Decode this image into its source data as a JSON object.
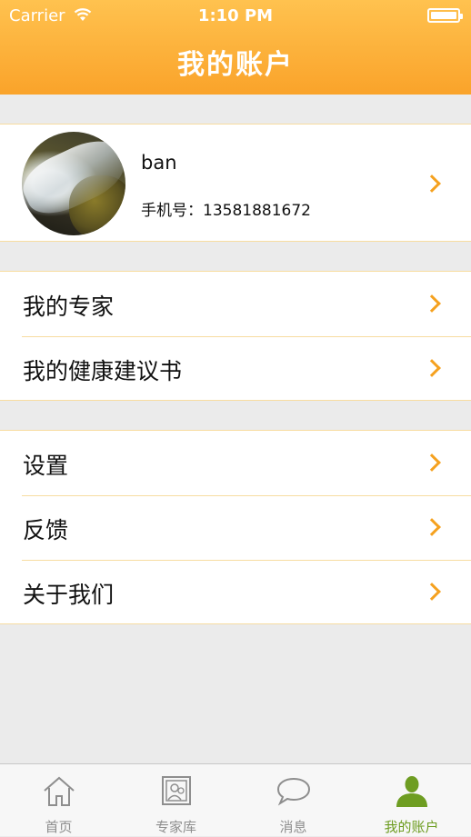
{
  "status_bar": {
    "carrier": "Carrier",
    "time": "1:10 PM",
    "battery_level_percent": 100
  },
  "header": {
    "title": "我的账户"
  },
  "profile": {
    "name": "ban",
    "phone_label": "手机号：",
    "phone_number": "13581881672"
  },
  "menu": {
    "group1": [
      {
        "label": "我的专家"
      },
      {
        "label": "我的健康建议书"
      }
    ],
    "group2": [
      {
        "label": "设置"
      },
      {
        "label": "反馈"
      },
      {
        "label": "关于我们"
      }
    ]
  },
  "tabbar": {
    "items": [
      {
        "label": "首页",
        "icon": "home-icon"
      },
      {
        "label": "专家库",
        "icon": "expert-library-icon"
      },
      {
        "label": "消息",
        "icon": "message-bubble-icon"
      },
      {
        "label": "我的账户",
        "icon": "user-icon",
        "active": true
      }
    ],
    "active_color": "#6e9d22",
    "inactive_color": "#8e8e8e"
  },
  "colors": {
    "header_gradient_top": "#ffc24f",
    "header_gradient_bottom": "#faa32a",
    "chevron": "#f5a11f",
    "background": "#ebebeb"
  }
}
